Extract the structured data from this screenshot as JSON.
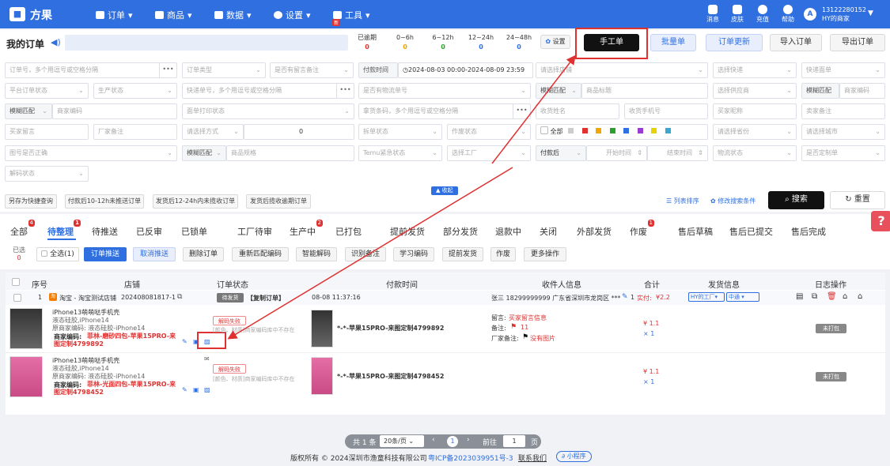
{
  "app": {
    "name": "方果"
  },
  "topnav": [
    {
      "label": "订单",
      "icon": "clipboard-icon"
    },
    {
      "label": "商品",
      "icon": "box-icon"
    },
    {
      "label": "数据",
      "icon": "chart-icon"
    },
    {
      "label": "设置",
      "icon": "gear-icon"
    },
    {
      "label": "工具",
      "icon": "gift-icon",
      "badge": "新"
    }
  ],
  "topright": [
    {
      "label": "消息",
      "icon": "chat-icon"
    },
    {
      "label": "皮肤",
      "icon": "shirt-icon"
    },
    {
      "label": "充值",
      "icon": "wallet-icon"
    },
    {
      "label": "帮助",
      "icon": "help-icon"
    }
  ],
  "user": {
    "avatar": "A",
    "phone": "13122280152",
    "name": "HY的商家"
  },
  "page": {
    "title": "我的订单"
  },
  "stats": [
    {
      "label": "已逾期",
      "value": "0"
    },
    {
      "label": "0~6h",
      "value": "0"
    },
    {
      "label": "6~12h",
      "value": "0"
    },
    {
      "label": "12~24h",
      "value": "0"
    },
    {
      "label": "24~48h",
      "value": "0"
    }
  ],
  "buttons": {
    "settings": "设置",
    "manual": "手工单",
    "batch": "批量单",
    "update": "订单更新",
    "import": "导入订单",
    "export": "导出订单"
  },
  "filters": {
    "row1": [
      "订单号，多个用逗号或空格分隔",
      "订单类型",
      "是否有留言备注",
      "付款时间",
      "2024-08-03 00:00",
      "2024-08-09 23:59",
      "请选择店铺",
      "选择快递",
      "快递面单"
    ],
    "row2": [
      "平台订单状态",
      "生产状态",
      "快递单号，多个用逗号或空格分隔",
      "是否有物流单号",
      "模糊匹配",
      "商品标题",
      "选择供应商",
      "模糊匹配",
      "商家编码"
    ],
    "row3": [
      "模糊匹配",
      "商家编码",
      "面单打印状态",
      "拿货条码，多个用逗号或空格分隔",
      "收货姓名",
      "收货手机号",
      "买家昵称",
      "卖家备注"
    ],
    "row4": [
      "买家留言",
      "厂家备注",
      "请选择方式",
      "0",
      "拆单状态",
      "作废状态",
      "全部",
      "请选择省份",
      "请选择城市"
    ],
    "row5": [
      "图号是否正确",
      "模糊匹配",
      "商品规格",
      "Temu紧急状态",
      "选择工厂",
      "付款后",
      "开始时间",
      "结束时间",
      "物流状态",
      "是否定制单"
    ],
    "row6": [
      "解码状态"
    ]
  },
  "quick": {
    "save": "另存为快捷查询",
    "q1": "付款后10-12h未推送订单",
    "q2": "发货后12-24h内未揽收订单",
    "q3": "发货后揽收逾期订单",
    "collapse": "收起",
    "sort": "列表排序",
    "modify": "修改搜索条件",
    "search": "搜索",
    "reset": "重置"
  },
  "tabs": [
    {
      "label": "全部",
      "badge": "4"
    },
    {
      "label": "待整理",
      "badge": "1"
    },
    {
      "label": "待推送"
    },
    {
      "label": "已反审"
    },
    {
      "label": "已锁单"
    },
    {
      "label": "工厂待审"
    },
    {
      "label": "生产中",
      "badge": "2"
    },
    {
      "label": "已打包"
    },
    {
      "label": "提前发货"
    },
    {
      "label": "部分发货"
    },
    {
      "label": "退款中"
    },
    {
      "label": "关闭"
    },
    {
      "label": "外部发货"
    },
    {
      "label": "作废",
      "badge": "1"
    },
    {
      "label": "售后草稿"
    },
    {
      "label": "售后已提交"
    },
    {
      "label": "售后完成"
    }
  ],
  "actions": {
    "selected": "已选",
    "selected_count": "0",
    "select_all": "全选(1)",
    "list": [
      "订单推送",
      "取消推送",
      "删除订单",
      "重新匹配编码",
      "智能解码",
      "识别备注",
      "学习编码",
      "提前发货",
      "作废",
      "更多操作"
    ]
  },
  "table": {
    "headers": [
      "序号",
      "店铺",
      "订单状态",
      "付款时间",
      "收件人信息",
      "合计",
      "发货信息",
      "日志操作"
    ],
    "order": {
      "index": "1",
      "platform": "淘",
      "shop": "淘宝 - 淘宝测试店铺",
      "order_id": "202408081817-1",
      "status": "待发货",
      "tag": "【复制订单】",
      "pay_time": "08-08 11:37:16",
      "receiver": "张三 18299999999 广东省深圳市龙岗区 ***",
      "edit": "1",
      "paid_label": "实付:",
      "paid": "¥2.2",
      "factory": "HY的工厂",
      "express": "中通"
    },
    "items": [
      {
        "title": "iPhone13萌萌哒手机壳",
        "sku": "液态硅胶,iPhone14",
        "orig": "原商家编码: 液态硅胶-iPhone14",
        "code_label": "商家编码:",
        "code": "菲林-磨砂四包-苹果15PRO-来图定制4799892",
        "decode": "解码失败",
        "decode_msg": "[颜色、材质]商家编码库中不存在",
        "spec": "*-*-苹果15PRO-来图定制4799892",
        "price": "¥ 1.1",
        "qty": "× 1",
        "pack": "未打包"
      },
      {
        "title": "iPhone13萌萌哒手机壳",
        "sku": "液态硅胶,iPhone14",
        "orig": "原商家编码: 液态硅胶-iPhone14",
        "code_label": "商家编码:",
        "code": "菲林-光面四包-苹果15PRO-来图定制4798452",
        "decode": "解码失败",
        "decode_msg": "[颜色、材质]商家编码库中不存在",
        "spec": "*-*-苹果15PRO-来图定制4798452",
        "price": "¥ 1.1",
        "qty": "× 1",
        "pack": "未打包"
      }
    ],
    "notes": {
      "msg_label": "留言:",
      "msg": "买家留言信息",
      "remark_label": "备注:",
      "remark": "11",
      "factory_label": "厂家备注:",
      "factory": "没有图片"
    }
  },
  "pagination": {
    "total": "共 1 条",
    "size": "20条/页",
    "page": "1",
    "goto": "前往",
    "goto_value": "1",
    "unit": "页"
  },
  "footer": {
    "copyright": "版权所有 © 2024深圳市渔童科技有限公司",
    "icp": "粤ICP备2023039951号-3",
    "contact": "联系我们",
    "mini": "小程序"
  },
  "colors": {
    "primary": "#2f6fdf",
    "danger": "#e03131"
  }
}
